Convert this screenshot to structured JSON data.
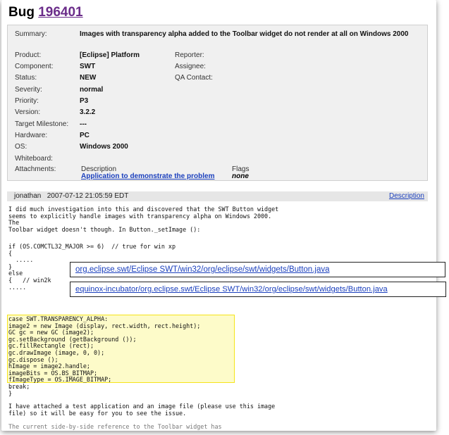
{
  "bug": {
    "title_prefix": "Bug",
    "id": "196401"
  },
  "details": {
    "summary_label": "Summary:",
    "summary_value": "Images with transparency alpha added to the Toolbar widget do not render at all on Windows 2000",
    "product_label": "Product:",
    "product_value": "[Eclipse] Platform",
    "component_label": "Component:",
    "component_value": "SWT",
    "status_label": "Status:",
    "status_value": "NEW",
    "severity_label": "Severity:",
    "severity_value": "normal",
    "priority_label": "Priority:",
    "priority_value": "P3",
    "version_label": "Version:",
    "version_value": "3.2.2",
    "milestone_label": "Target Milestone:",
    "milestone_value": "---",
    "hardware_label": "Hardware:",
    "hardware_value": "PC",
    "os_label": "OS:",
    "os_value": "Windows 2000",
    "whiteboard_label": "Whiteboard:",
    "attachments_label": "Attachments:",
    "reporter_label": "Reporter:",
    "assignee_label": "Assignee:",
    "qa_label": "QA Contact:",
    "attach_col_description": "Description",
    "attach_col_flags": "Flags",
    "attach_link": "Application to demonstrate the problem",
    "attach_flag_value": "none"
  },
  "comment": {
    "author": "jonathan",
    "timestamp": "2007-07-12 21:05:59 EDT",
    "description_link": "Description",
    "text_intro": "I did much investigation into this and discovered that the SWT Button widget\nseems to explicitly handle images with transparency alpha on Windows 2000.\nThe\nToolbar widget doesn't though. In Button._setImage ():",
    "code_1": "if (OS.COMCTL32_MAJOR >= 6)  // true for win xp\n{\n  .....\n}\nelse\n{   // win2k\n.....",
    "code_highlighted": "case SWT.TRANSPARENCY_ALPHA:\nimage2 = new Image (display, rect.width, rect.height);\nGC gc = new GC (image2);\ngc.setBackground (getBackground ());\ngc.fillRectangle (rect);\ngc.drawImage (image, 0, 0);\ngc.dispose ();\nhImage = image2.handle;\nimageBits = OS.BS_BITMAP;\nfImageType = OS.IMAGE_BITMAP;\nbreak;",
    "code_2": "...\n}",
    "text_outro": "I have attached a test application and an image file (please use this image\nfile) so it will be easy for you to see the issue.",
    "text_cut": "The current side-by-side reference to the Toolbar widget has"
  },
  "overlay_links": {
    "link_1": "org.eclipse.swt/Eclipse SWT/win32/org/eclipse/swt/widgets/Button.java",
    "link_2": "equinox-incubator/org.eclipse.swt/Eclipse SWT/win32/org/eclipse/swt/widgets/Button.java"
  },
  "colors": {
    "link": "#1a3fbd",
    "bug_id_link": "#6b2d8a",
    "highlight_bg": "#fdfbc9",
    "highlight_border": "#f5e41a",
    "details_bg": "#f0f0f0"
  }
}
